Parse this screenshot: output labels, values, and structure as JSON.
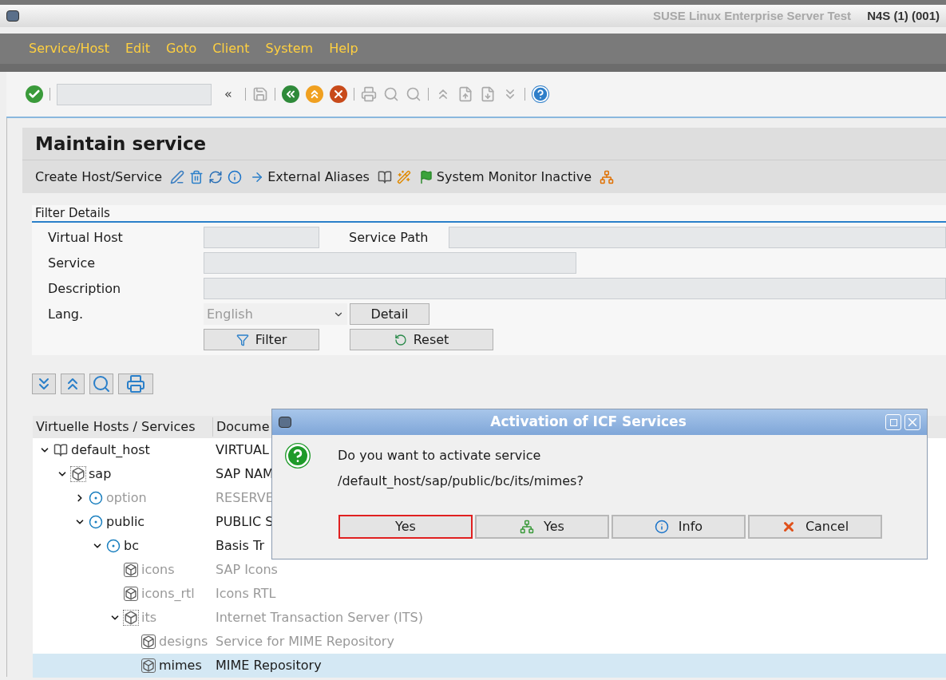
{
  "window": {
    "title_faded": "SUSE Linux Enterprise Server Test",
    "system": "N4S (1) (001)"
  },
  "menu": [
    "Service/Host",
    "Edit",
    "Goto",
    "Client",
    "System",
    "Help"
  ],
  "toolbar": {
    "history_button": "«"
  },
  "screen_title": "Maintain service",
  "app_toolbar": {
    "create_button": "Create Host/Service",
    "aliases_button": "External Aliases",
    "monitor_button": "System Monitor Inactive"
  },
  "filter": {
    "title": "Filter Details",
    "virtual_host_label": "Virtual Host",
    "service_path_label": "Service Path",
    "service_label": "Service",
    "description_label": "Description",
    "lang_label": "Lang.",
    "lang_value": "English",
    "detail_button": "Detail",
    "filter_button": "Filter",
    "reset_button": "Reset"
  },
  "tree": {
    "columns": [
      "Virtuelle Hosts / Services",
      "Docume"
    ],
    "rows": [
      {
        "name": "default_host",
        "doc": "VIRTUAL",
        "kind": "host",
        "inactive": false,
        "selected": false,
        "expanded": true,
        "children": [
          {
            "name": "sap",
            "doc": "SAP NAM",
            "kind": "package-dotted",
            "inactive": false,
            "selected": false,
            "expanded": true,
            "children": [
              {
                "name": "option",
                "doc": "RESERVE",
                "kind": "node",
                "inactive": true,
                "selected": false,
                "expanded": false
              },
              {
                "name": "public",
                "doc": "PUBLIC S",
                "kind": "node",
                "inactive": false,
                "selected": false,
                "expanded": true,
                "children": [
                  {
                    "name": "bc",
                    "doc": "Basis Tr",
                    "kind": "node",
                    "inactive": false,
                    "selected": false,
                    "expanded": true,
                    "children": [
                      {
                        "name": "icons",
                        "doc": "SAP Icons",
                        "kind": "package",
                        "inactive": true,
                        "selected": false
                      },
                      {
                        "name": "icons_rtl",
                        "doc": "Icons RTL",
                        "kind": "package",
                        "inactive": true,
                        "selected": false
                      },
                      {
                        "name": "its",
                        "doc": "Internet Transaction Server (ITS)",
                        "kind": "package-dotted",
                        "inactive": true,
                        "selected": false,
                        "expanded": true,
                        "children": [
                          {
                            "name": "designs",
                            "doc": "Service for MIME Repository",
                            "kind": "package",
                            "inactive": true,
                            "selected": false
                          },
                          {
                            "name": "mimes",
                            "doc": "MIME Repository",
                            "kind": "package",
                            "inactive": false,
                            "selected": true
                          }
                        ]
                      }
                    ]
                  }
                ]
              }
            ]
          }
        ]
      }
    ]
  },
  "dialog": {
    "title": "Activation of ICF Services",
    "message": "Do you want to activate service",
    "path": "/default_host/sap/public/bc/its/mimes?",
    "buttons": [
      {
        "kind": "plain",
        "label": "Yes",
        "focused": true
      },
      {
        "kind": "hierarchy",
        "label": "Yes",
        "focused": false
      },
      {
        "kind": "info",
        "label": "Info",
        "focused": false
      },
      {
        "kind": "cancel",
        "label": "Cancel",
        "focused": false
      }
    ]
  }
}
